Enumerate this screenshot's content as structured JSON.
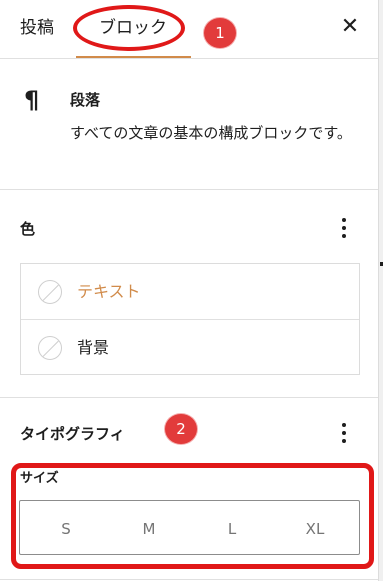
{
  "tabs": {
    "post_label": "投稿",
    "block_label": "ブロック",
    "close_glyph": "✕"
  },
  "annotations": {
    "badge1": "1",
    "badge2": "2"
  },
  "block": {
    "icon_glyph": "¶",
    "title": "段落",
    "description": "すべての文章の基本の構成ブロックです。"
  },
  "color_section": {
    "title": "色",
    "options": [
      {
        "label": "テキスト"
      },
      {
        "label": "背景"
      }
    ]
  },
  "typography": {
    "title": "タイポグラフィ",
    "size_label": "サイズ",
    "size_options": [
      "S",
      "M",
      "L",
      "XL"
    ]
  },
  "colors": {
    "accent": "#d18b4a",
    "annotation_red": "#e01818",
    "badge_red": "#e23b3b"
  }
}
